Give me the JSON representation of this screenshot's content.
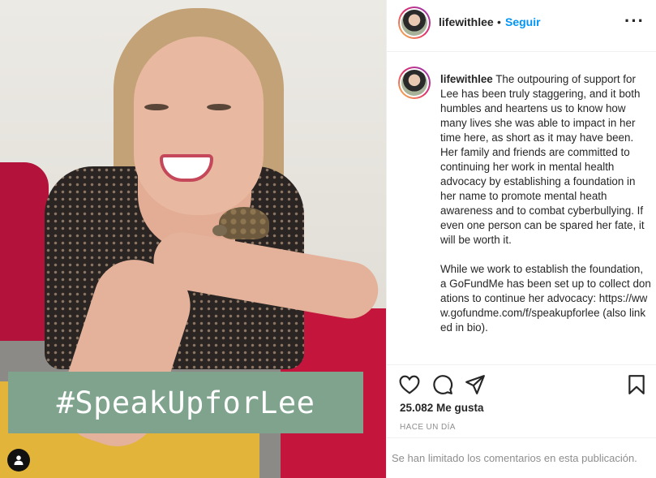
{
  "post": {
    "hashtag_overlay": "#SpeakUpforLee",
    "image_alt": "user-tag-icon"
  },
  "header": {
    "username": "lifewithlee",
    "separator": "•",
    "follow_label": "Seguir",
    "more_label": "···"
  },
  "caption": {
    "username": "lifewithlee",
    "paragraph_1": "The outpouring of support for Lee has been truly staggering, and it both humbles and heartens us to know how many lives she was able to impact in her time here, as short as it may have been. Her family and friends are committed to continuing her work in mental health advocacy by establishing a foundation in her name to promote mental heath awareness and to combat cyberbullying. If even one person can be spared her fate, it will be worth it.",
    "paragraph_2": "While we work to establish the foundation, a GoFundMe has been set up to collect donations to continue her advocacy: https://www.gofundme.com/f/speakupforlee (also linked in bio)."
  },
  "actions": {
    "like_icon": "heart-icon",
    "comment_icon": "comment-icon",
    "share_icon": "send-icon",
    "save_icon": "bookmark-icon",
    "likes_text": "25.082 Me gusta",
    "timestamp": "HACE UN DÍA",
    "comments_limited": "Se han limitado los comentarios en esta publicación."
  },
  "colors": {
    "accent": "#0095f6",
    "hashtag_bg": "#7fa38d",
    "muted_text": "#8e8e8e",
    "border": "#efefef"
  }
}
